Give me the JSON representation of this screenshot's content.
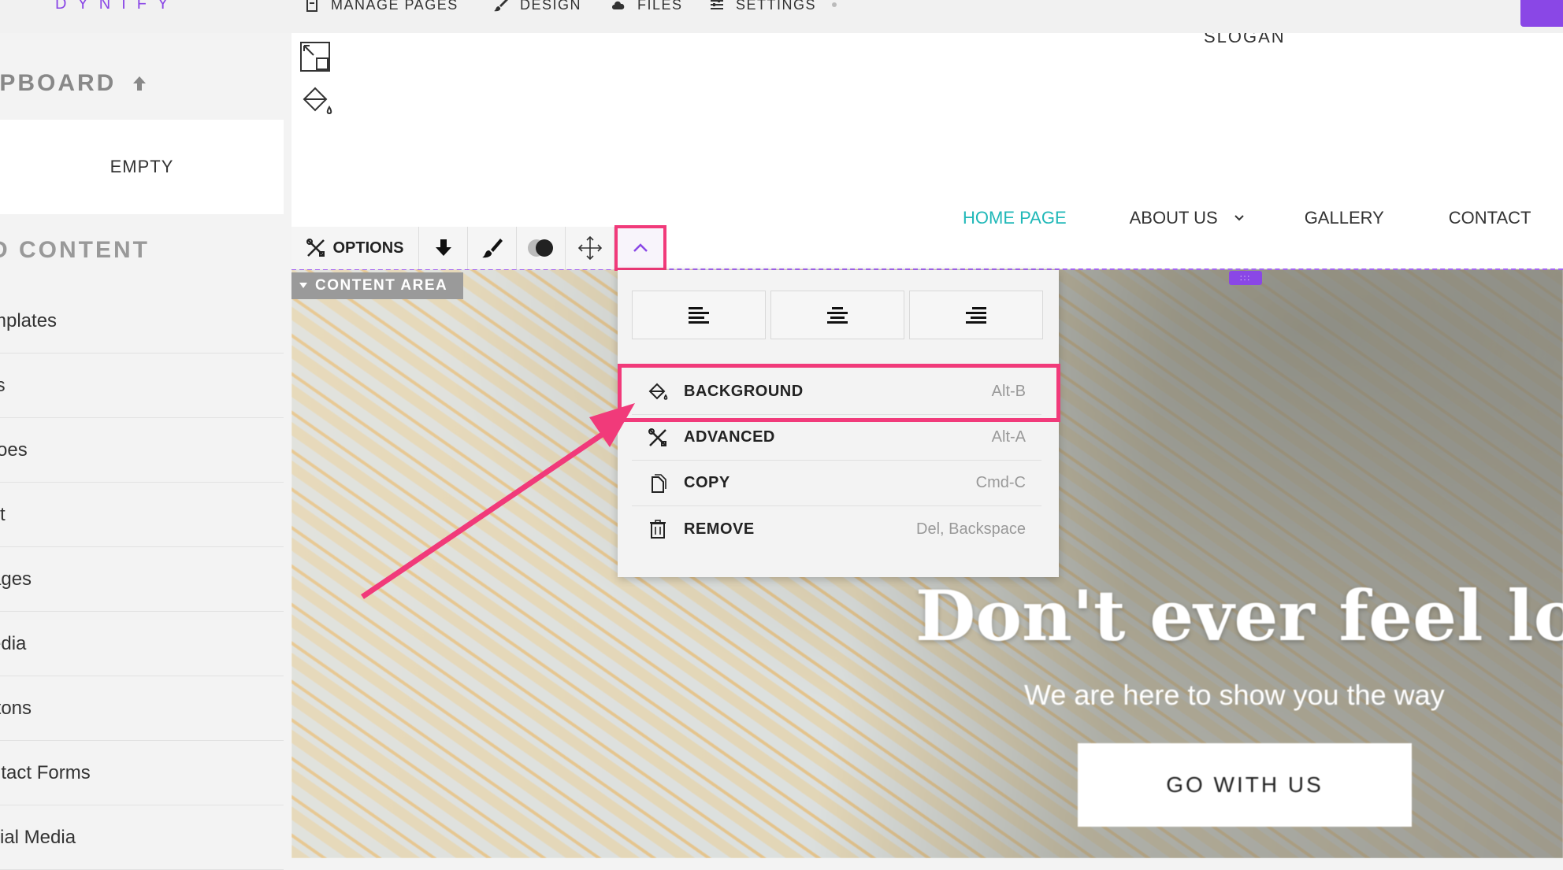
{
  "topbar": {
    "brand": "DYNIFY",
    "nav": {
      "manage_pages": "MANAGE PAGES",
      "design": "DESIGN",
      "files": "FILES",
      "settings": "SETTINGS"
    }
  },
  "sidebar": {
    "clipboard_title": "IPBOARD",
    "clipboard_empty": "EMPTY",
    "add_content_title": "D CONTENT",
    "items": [
      {
        "label": "mplates"
      },
      {
        "label": "ts"
      },
      {
        "label": "roes"
      },
      {
        "label": "xt"
      },
      {
        "label": "ages"
      },
      {
        "label": "edia"
      },
      {
        "label": "ttons"
      },
      {
        "label": "ntact Forms"
      },
      {
        "label": "cial Media"
      }
    ]
  },
  "site": {
    "slogan": "SLOGAN",
    "nav": {
      "home": "HOME PAGE",
      "about": "ABOUT US",
      "gallery": "GALLERY",
      "contact": "CONTACT"
    },
    "hero": {
      "title": "Don't ever feel lost!",
      "subtitle": "We are here to show you the way",
      "cta": "GO WITH US"
    }
  },
  "toolbar": {
    "options_label": "OPTIONS",
    "content_area_label": "CONTENT AREA"
  },
  "dropdown": {
    "items": [
      {
        "label": "BACKGROUND",
        "shortcut": "Alt-B",
        "icon": "paint-bucket-icon"
      },
      {
        "label": "ADVANCED",
        "shortcut": "Alt-A",
        "icon": "tools-icon"
      },
      {
        "label": "COPY",
        "shortcut": "Cmd-C",
        "icon": "copy-icon"
      },
      {
        "label": "REMOVE",
        "shortcut": "Del, Backspace",
        "icon": "trash-icon"
      }
    ]
  },
  "colors": {
    "brand": "#8a47e6",
    "highlight": "#f13a7a",
    "active_nav": "#20b8b8"
  }
}
